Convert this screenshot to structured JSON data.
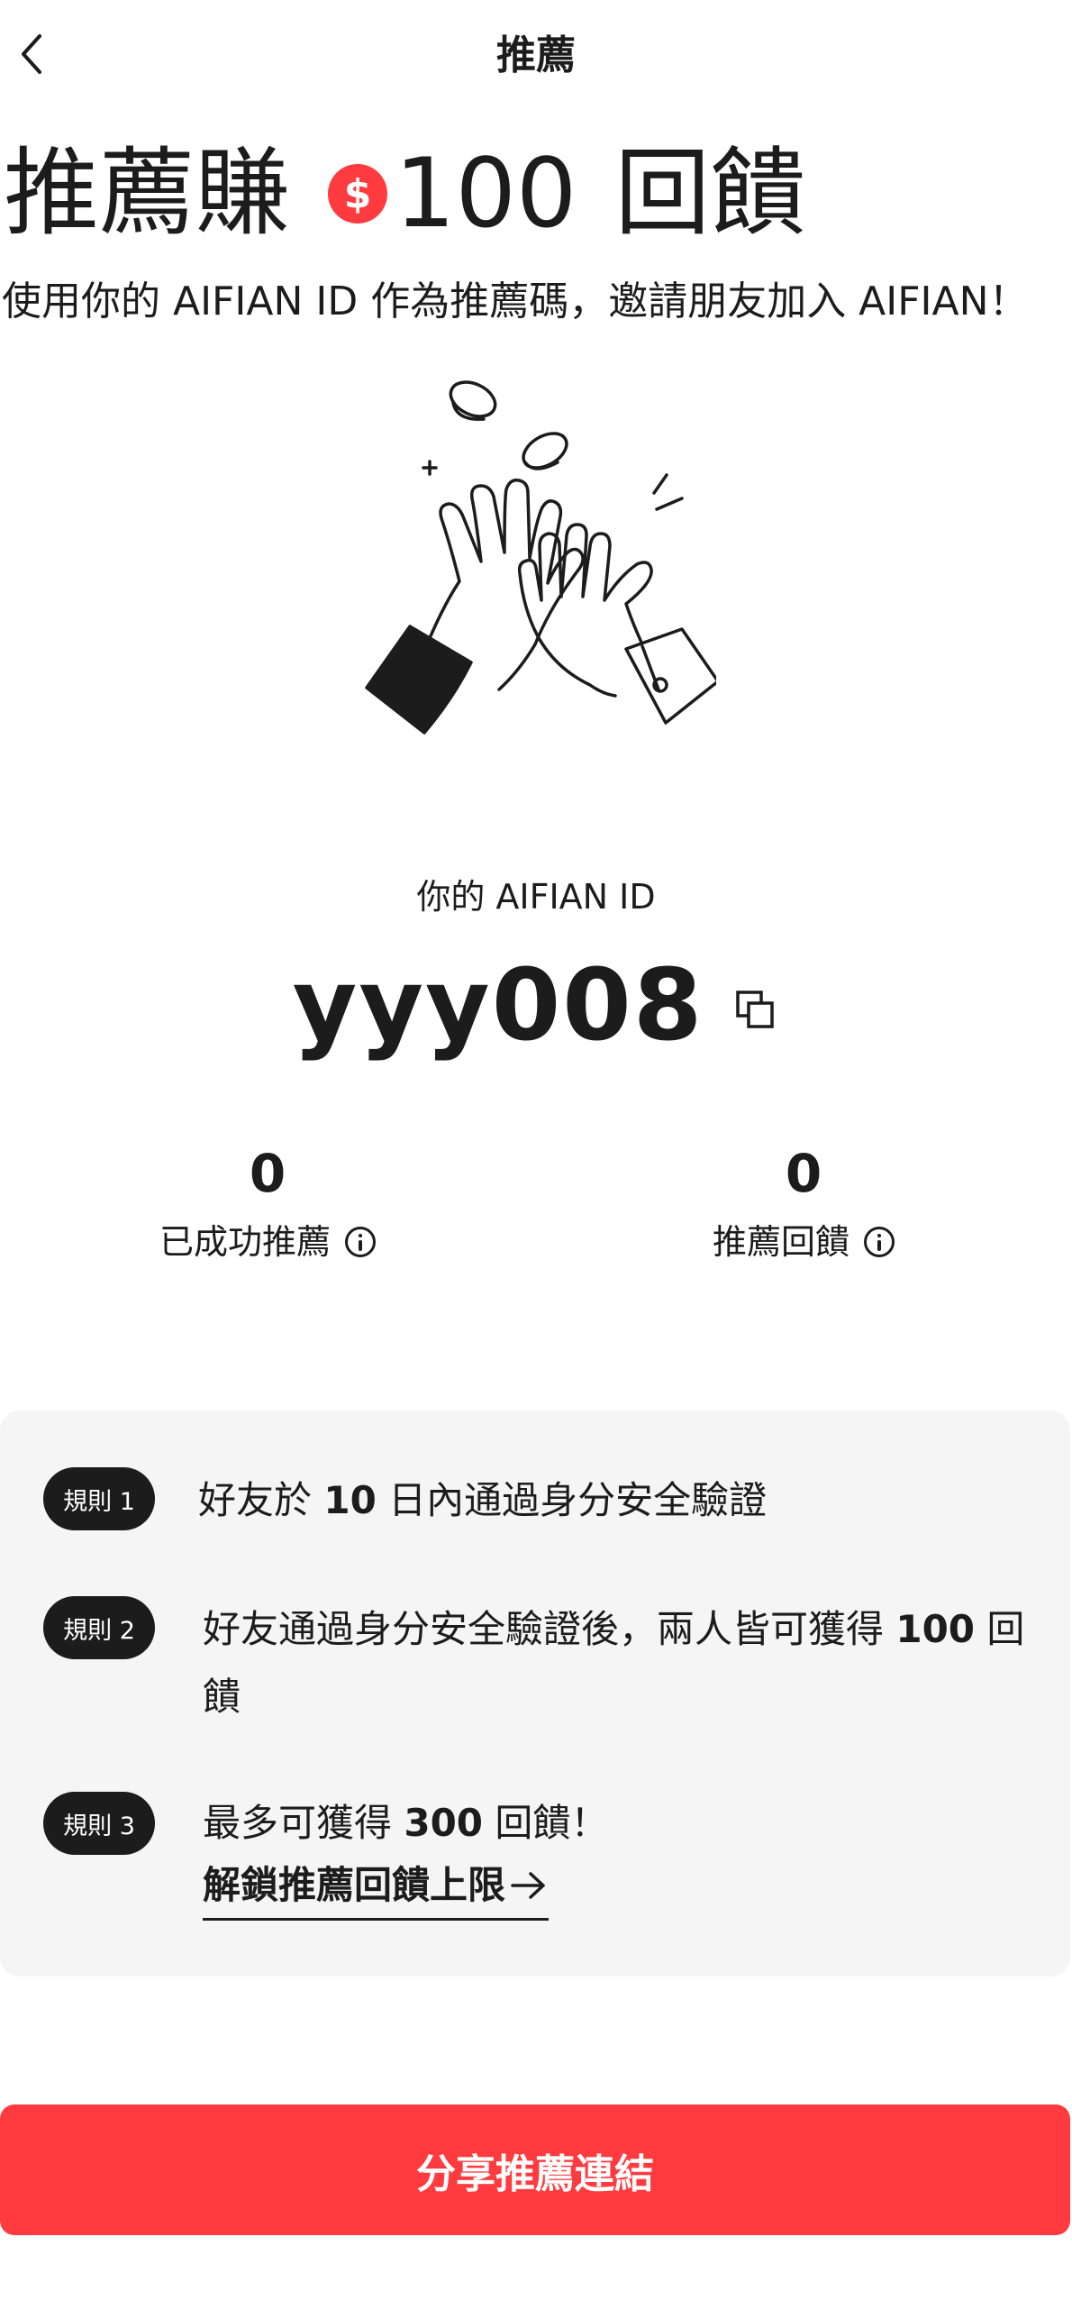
{
  "header": {
    "title": "推薦"
  },
  "hero": {
    "title_prefix": "推薦賺",
    "coin_symbol": "$",
    "amount": "100",
    "title_suffix": "回饋",
    "subtitle": "使用你的 AIFIAN ID 作為推薦碼，邀請朋友加入 AIFIAN！"
  },
  "profile": {
    "id_label": "你的 AIFIAN ID",
    "id_value": "yyy008"
  },
  "stats": [
    {
      "value": "0",
      "label": "已成功推薦"
    },
    {
      "value": "0",
      "label": "推薦回饋"
    }
  ],
  "rules": [
    {
      "badge": "規則 1",
      "pre": "好友於 ",
      "bold": "10",
      "post": " 日內通過身分安全驗證"
    },
    {
      "badge": "規則 2",
      "line1_pre": "好友通過身分安全驗證後，兩人皆可獲得 ",
      "line1_bold": "100",
      "line1_post": " 回",
      "line2": "饋"
    },
    {
      "badge": "規則 3",
      "pre": "最多可獲得 ",
      "bold": "300",
      "post": " 回饋！",
      "link": "解鎖推薦回饋上限"
    }
  ],
  "share_button": "分享推薦連結",
  "colors": {
    "accent": "#ff3b3f",
    "dark": "#1c1c1c",
    "panel": "#f5f5f5"
  }
}
